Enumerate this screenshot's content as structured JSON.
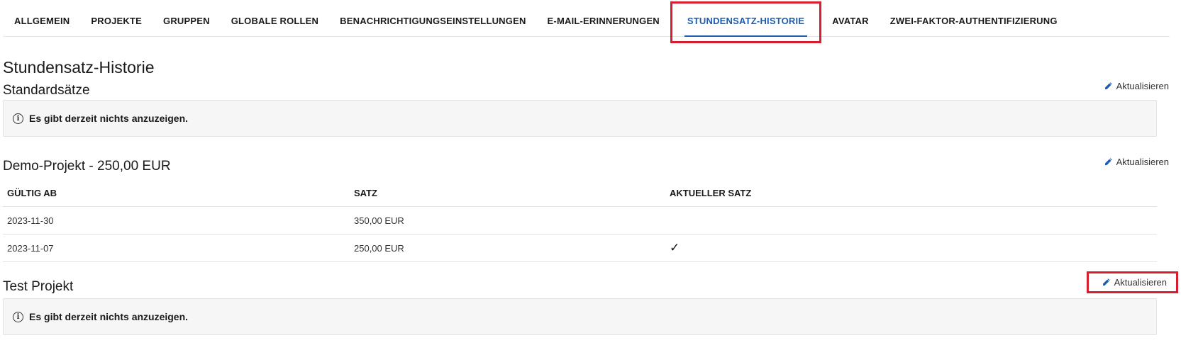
{
  "tabs": [
    {
      "label": "ALLGEMEIN",
      "active": false
    },
    {
      "label": "PROJEKTE",
      "active": false
    },
    {
      "label": "GRUPPEN",
      "active": false
    },
    {
      "label": "GLOBALE ROLLEN",
      "active": false
    },
    {
      "label": "BENACHRICHTIGUNGSEINSTELLUNGEN",
      "active": false
    },
    {
      "label": "E-MAIL-ERINNERUNGEN",
      "active": false
    },
    {
      "label": "STUNDENSATZ-HISTORIE",
      "active": true
    },
    {
      "label": "AVATAR",
      "active": false
    },
    {
      "label": "ZWEI-FAKTOR-AUTHENTIFIZIERUNG",
      "active": false
    }
  ],
  "page_title": "Stundensatz-Historie",
  "edit_label": "Aktualisieren",
  "empty_notice": "Es gibt derzeit nichts anzuzeigen.",
  "sections": {
    "default": {
      "title": "Standardsätze"
    },
    "demo": {
      "title": "Demo-Projekt - 250,00 EUR",
      "columns": [
        "GÜLTIG AB",
        "SATZ",
        "AKTUELLER SATZ"
      ],
      "rows": [
        {
          "valid_from": "2023-11-30",
          "rate": "350,00 EUR",
          "current": false
        },
        {
          "valid_from": "2023-11-07",
          "rate": "250,00 EUR",
          "current": true
        }
      ]
    },
    "test": {
      "title": "Test Projekt"
    }
  },
  "colors": {
    "accent": "#1a5db5",
    "highlight": "#d81e2c"
  },
  "icons": {
    "edit": "pencil-icon",
    "info": "info-icon",
    "check": "checkmark-icon"
  }
}
